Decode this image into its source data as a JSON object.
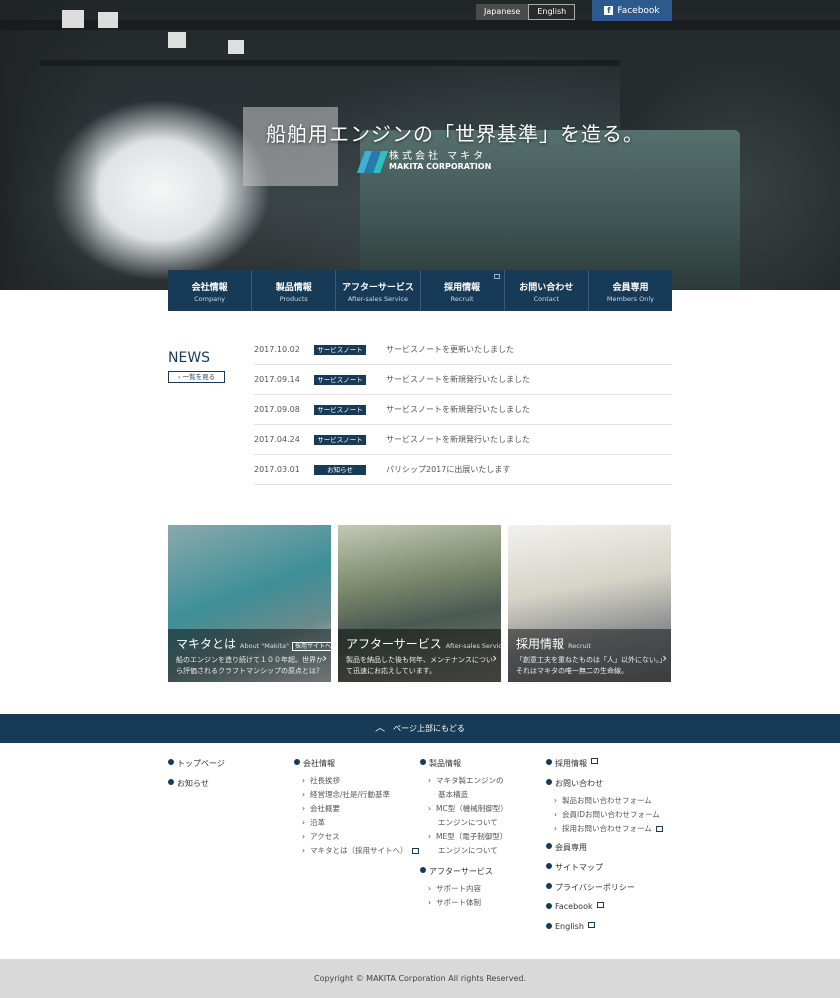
{
  "hero": {
    "tagline": "船舶用エンジンの「世界基準」を造る。",
    "logo_jp": "株式会社 マキタ",
    "logo_en": "MAKITA CORPORATION"
  },
  "lang": {
    "japanese": "Japanese",
    "english": "English"
  },
  "facebook": {
    "label": "Facebook"
  },
  "gnav": [
    {
      "jp": "会社情報",
      "en": "Company"
    },
    {
      "jp": "製品情報",
      "en": "Products"
    },
    {
      "jp": "アフターサービス",
      "en": "After-sales Service"
    },
    {
      "jp": "採用情報",
      "en": "Recruit"
    },
    {
      "jp": "お問い合わせ",
      "en": "Contact"
    },
    {
      "jp": "会員専用",
      "en": "Members Only"
    }
  ],
  "news": {
    "title": "NEWS",
    "more": "一覧を見る",
    "items": [
      {
        "date": "2017.10.02",
        "tag": "サービスノート",
        "text": "サービスノートを更新いたしました"
      },
      {
        "date": "2017.09.14",
        "tag": "サービスノート",
        "text": "サービスノートを新規発行いたしました"
      },
      {
        "date": "2017.09.08",
        "tag": "サービスノート",
        "text": "サービスノートを新規発行いたしました"
      },
      {
        "date": "2017.04.24",
        "tag": "サービスノート",
        "text": "サービスノートを新規発行いたしました"
      },
      {
        "date": "2017.03.01",
        "tag": "お知らせ",
        "text": "パリシップ2017に出展いたします"
      }
    ]
  },
  "cards": [
    {
      "title": "マキタとは",
      "sub": "About \"Makita\"",
      "badge": "採用サイトへ",
      "desc": "船のエンジンを造り続けて１００年超。世界から評価されるクラフトマンシップの原点とは？"
    },
    {
      "title": "アフターサービス",
      "sub": "After-sales Service",
      "desc": "製品を納品した後も何年、メンテナンスについて迅速にお応えしています。"
    },
    {
      "title": "採用情報",
      "sub": "Recruit",
      "desc": "「創意工夫を重ねたものは「人」以外にない。」それはマキタの唯一無二の生命線。"
    }
  ],
  "totop": "ページ上部にもどる",
  "sitemap": {
    "col1": [
      "トップページ",
      "お知らせ"
    ],
    "col2": {
      "head": "会社情報",
      "items": [
        "社長挨拶",
        "経営理念/社是/行動基準",
        "会社概要",
        "沿革",
        "アクセス",
        "マキタとは（採用サイトへ）"
      ]
    },
    "col3": {
      "head": "製品情報",
      "items": [
        "マキタ製エンジンの",
        "基本構造",
        "MC型（機械制御型）",
        "エンジンについて",
        "ME型（電子制御型）",
        "エンジンについて"
      ],
      "head2": "アフターサービス",
      "items2": [
        "サポート内容",
        "サポート体制"
      ]
    },
    "col4": {
      "recruit": "採用情報",
      "contact": "お問い合わせ",
      "contact_items": [
        "製品お問い合わせフォーム",
        "会員IDお問い合わせフォーム",
        "採用お問い合わせフォーム"
      ],
      "members": "会員専用",
      "sitemap": "サイトマップ",
      "privacy": "プライバシーポリシー",
      "facebook": "Facebook",
      "english": "English"
    }
  },
  "copyright": "Copyright © MAKITA Corporation All rights Reserved.",
  "colors": {
    "navy": "#173a57",
    "facebook": "#2c5a8c",
    "footer_bg": "#d9d9d9"
  }
}
